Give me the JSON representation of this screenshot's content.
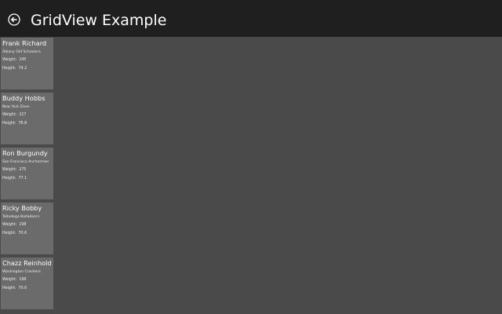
{
  "header": {
    "title": "GridView Example",
    "back_icon": "back-arrow-circle-icon"
  },
  "labels": {
    "weight": "Weight:",
    "height": "Height:"
  },
  "items": [
    {
      "name": "Frank Richard",
      "team": "Albany Old Schoolers",
      "weight": "245",
      "height": "74.2"
    },
    {
      "name": "Buddy Hobbs",
      "team": "New York Elves",
      "weight": "227",
      "height": "76.8"
    },
    {
      "name": "Ron Burgundy",
      "team": "San Francisco Anchormen",
      "weight": "275",
      "height": "77.1"
    },
    {
      "name": "Ricky Bobby",
      "team": "Talladega Balladeers",
      "weight": "198",
      "height": "70.6"
    },
    {
      "name": "Chazz Reinhold",
      "team": "Washington Crashers",
      "weight": "198",
      "height": "70.6"
    }
  ],
  "colors": {
    "header_bg": "#1f1f1f",
    "page_bg": "#4a4a4a",
    "card_bg": "#6b6b6b",
    "text": "#ffffff"
  }
}
